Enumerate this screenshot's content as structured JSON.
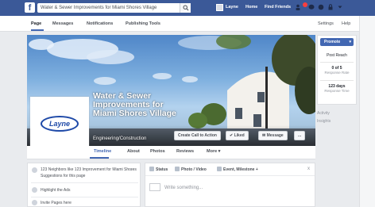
{
  "topbar": {
    "search_value": "Water & Sewer Improvements for Miami Shores Village",
    "nav_name": "Layne",
    "nav_home": "Home",
    "nav_find_friends": "Find Friends",
    "brand_color": "#3b5998"
  },
  "page_tabs": [
    {
      "label": "Page"
    },
    {
      "label": "Messages"
    },
    {
      "label": "Notifications"
    },
    {
      "label": "Publishing Tools"
    }
  ],
  "page_tabs_right": [
    {
      "label": "Settings"
    },
    {
      "label": "Help"
    }
  ],
  "profile": {
    "logo_text": "Layne",
    "page_name": "Water & Sewer Improvements for Miami Shores Village",
    "category": "Engineering/Construction"
  },
  "cover_buttons": {
    "cta": "Create Call to Action",
    "liked": "Liked",
    "message": "Message",
    "more": "..."
  },
  "sub_tabs": [
    {
      "label": "Timeline"
    },
    {
      "label": "About"
    },
    {
      "label": "Photos"
    },
    {
      "label": "Reviews"
    },
    {
      "label": "More"
    }
  ],
  "right_panel": {
    "promote": "Promote",
    "stat1_value": "Post Reach",
    "stat2_value": "0 of 5",
    "stat2_label": "Response Rate",
    "stat3_value": "123 days",
    "stat3_label": "Response Time",
    "link1": "Activity",
    "link2": "Insights"
  },
  "left_panel": {
    "line1": "123 Neighbors like 123 Improvement for Miami Shores",
    "line2": "Suggestions for this page",
    "line3": "Highlight the Ads",
    "line4": "Invite Pages here"
  },
  "composer": {
    "tab_status": "Status",
    "tab_photo": "Photo / Video",
    "tab_event": "Event, Milestone +",
    "placeholder": "Write something...",
    "close": "x"
  }
}
